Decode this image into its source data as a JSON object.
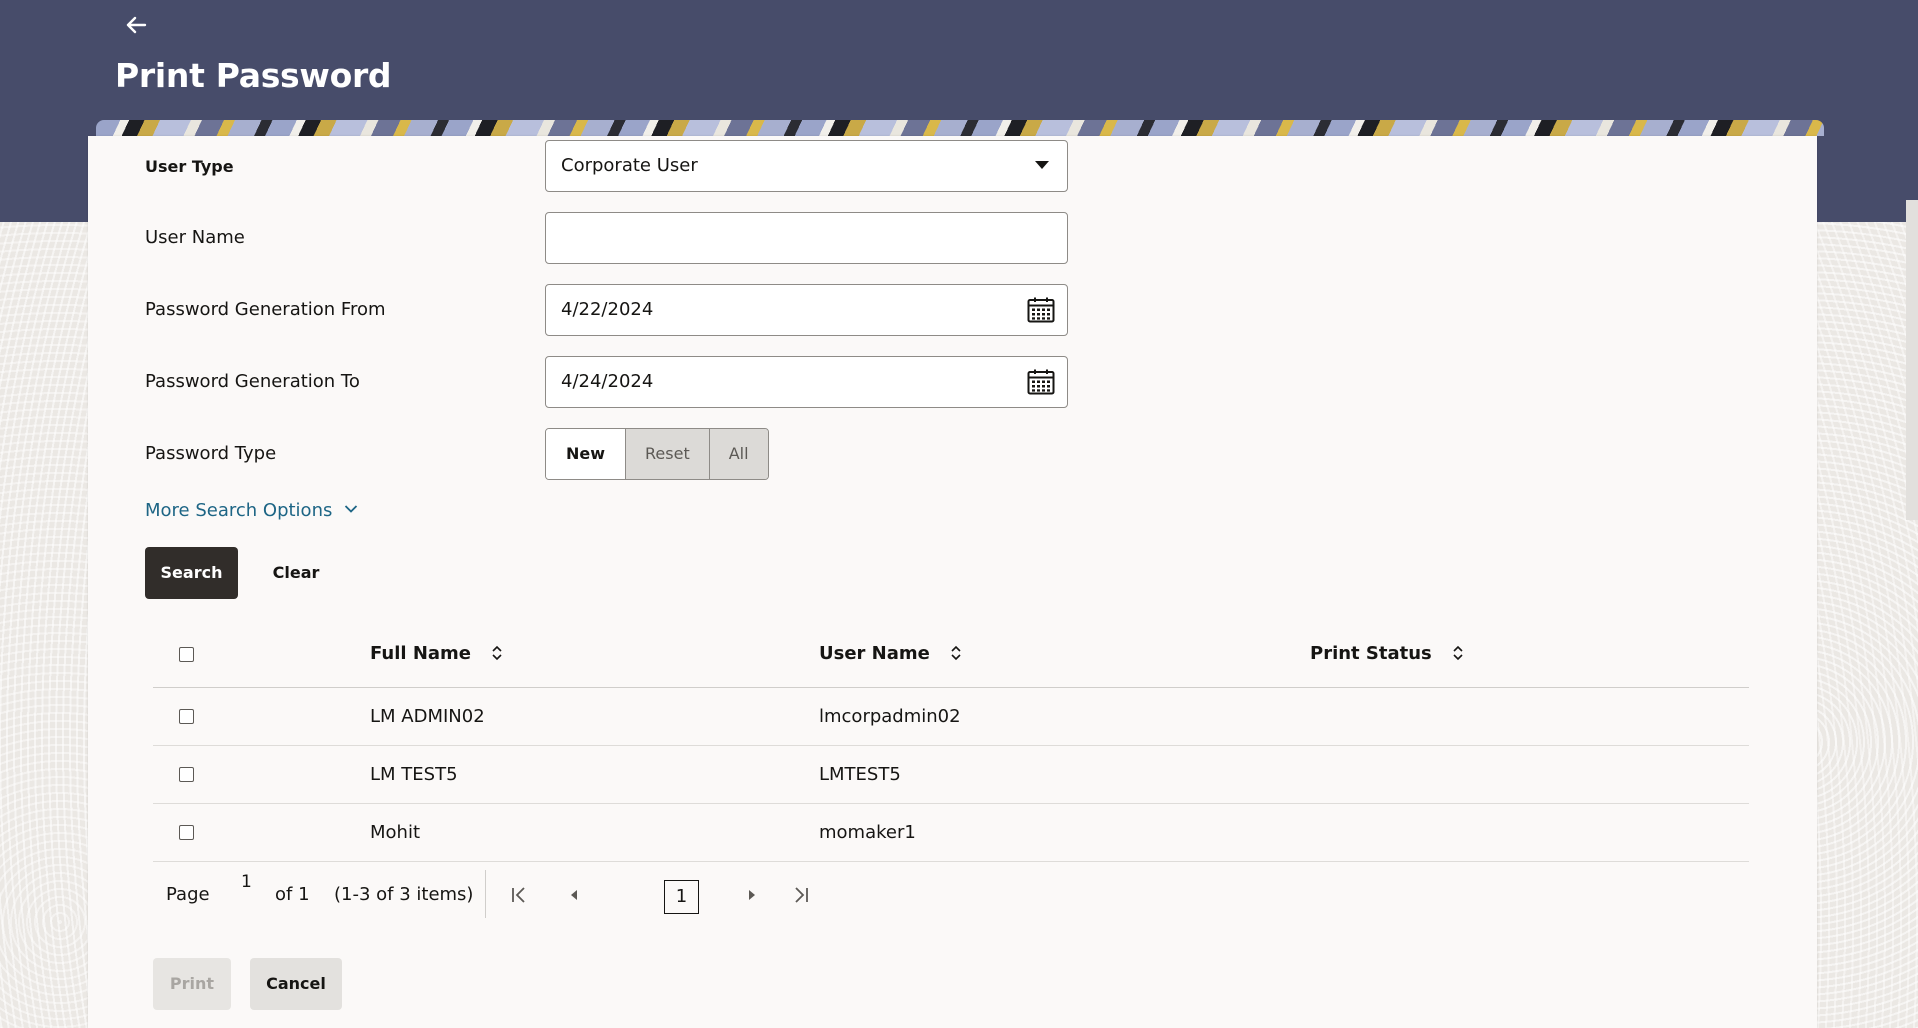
{
  "page": {
    "title": "Print Password"
  },
  "header": {
    "back_icon": "arrow-left-icon"
  },
  "form": {
    "user_type": {
      "label": "User Type",
      "value": "Corporate User"
    },
    "user_name": {
      "label": "User Name",
      "value": ""
    },
    "password_from": {
      "label": "Password Generation From",
      "value": "4/22/2024"
    },
    "password_to": {
      "label": "Password Generation To",
      "value": "4/24/2024"
    },
    "password_type": {
      "label": "Password Type",
      "options": [
        "New",
        "Reset",
        "All"
      ],
      "selected": "New"
    },
    "more_search_options": "More Search Options"
  },
  "actions": {
    "search": "Search",
    "clear": "Clear",
    "print": "Print",
    "cancel": "Cancel"
  },
  "table": {
    "columns": [
      "Full Name",
      "User Name",
      "Print Status"
    ],
    "rows": [
      {
        "full_name": "LM ADMIN02",
        "user_name": "lmcorpadmin02",
        "print_status": ""
      },
      {
        "full_name": "LM TEST5",
        "user_name": "LMTEST5",
        "print_status": ""
      },
      {
        "full_name": "Mohit",
        "user_name": "momaker1",
        "print_status": ""
      }
    ]
  },
  "pagination": {
    "page_label": "Page",
    "current_page": "1",
    "of_label": "of 1",
    "items_label": "(1-3 of 3 items)",
    "page_box": "1"
  },
  "colors": {
    "header_bg": "#474c6a",
    "primary_button": "#312d2a",
    "link": "#1d6585"
  }
}
